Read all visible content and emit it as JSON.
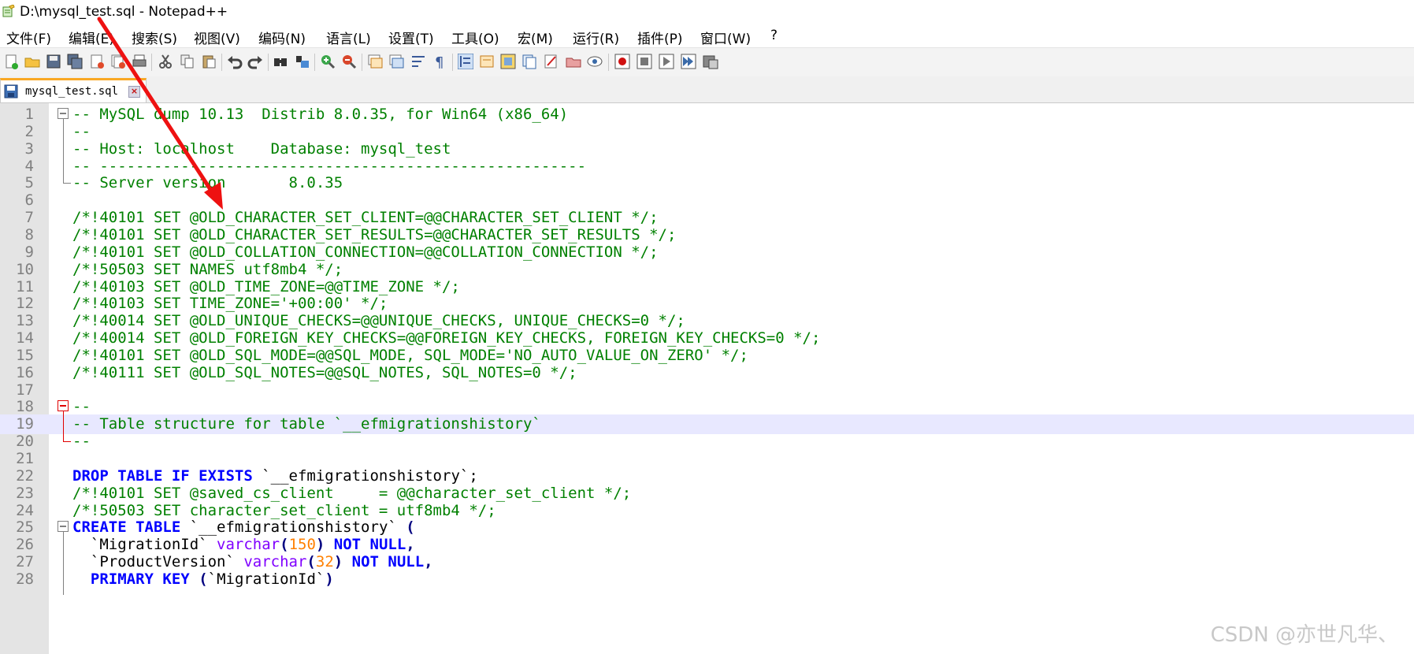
{
  "window": {
    "title": "D:\\mysql_test.sql - Notepad++"
  },
  "menu": [
    {
      "label": "文件(F)"
    },
    {
      "label": "编辑(E)"
    },
    {
      "label": "搜索(S)"
    },
    {
      "label": "视图(V)"
    },
    {
      "label": "编码(N)"
    },
    {
      "label": "语言(L)"
    },
    {
      "label": "设置(T)"
    },
    {
      "label": "工具(O)"
    },
    {
      "label": "宏(M)"
    },
    {
      "label": "运行(R)"
    },
    {
      "label": "插件(P)"
    },
    {
      "label": "窗口(W)"
    },
    {
      "label": "?"
    }
  ],
  "toolbar": {
    "icons": [
      "new-file-icon",
      "open-file-icon",
      "save-icon",
      "save-all-icon",
      "close-icon",
      "close-all-icon",
      "print-icon",
      "cut-icon",
      "copy-icon",
      "paste-icon",
      "undo-icon",
      "redo-icon",
      "find-icon",
      "replace-icon",
      "zoom-in-icon",
      "zoom-out-icon",
      "sync-vertical-icon",
      "sync-horizontal-icon",
      "word-wrap-icon",
      "show-all-chars-icon",
      "indent-guide-icon",
      "user-language-icon",
      "doc-map-icon",
      "function-list-icon",
      "folder-workspace-icon",
      "monitoring-icon",
      "doc-list-icon",
      "record-macro-icon",
      "stop-macro-icon",
      "play-macro-icon",
      "run-macro-multiple-icon",
      "save-macro-icon"
    ]
  },
  "tab": {
    "label": "mysql_test.sql"
  },
  "editor": {
    "current_line": 19,
    "lines": [
      {
        "n": "1",
        "segs": [
          {
            "t": "-- MySQL dump 10.13  Distrib 8.0.35, for Win64 (x86_64)",
            "c": "cmt"
          }
        ]
      },
      {
        "n": "2",
        "segs": [
          {
            "t": "--",
            "c": "cmt"
          }
        ]
      },
      {
        "n": "3",
        "segs": [
          {
            "t": "-- Host: localhost    Database: mysql_test",
            "c": "cmt"
          }
        ]
      },
      {
        "n": "4",
        "segs": [
          {
            "t": "-- ------------------------------------------------------",
            "c": "cmt"
          }
        ]
      },
      {
        "n": "5",
        "segs": [
          {
            "t": "-- Server version\t8.0.35",
            "c": "cmt"
          }
        ]
      },
      {
        "n": "6",
        "segs": []
      },
      {
        "n": "7",
        "segs": [
          {
            "t": "/*!40101 SET @OLD_CHARACTER_SET_CLIENT=@@CHARACTER_SET_CLIENT */;",
            "c": "cmt"
          }
        ]
      },
      {
        "n": "8",
        "segs": [
          {
            "t": "/*!40101 SET @OLD_CHARACTER_SET_RESULTS=@@CHARACTER_SET_RESULTS */;",
            "c": "cmt"
          }
        ]
      },
      {
        "n": "9",
        "segs": [
          {
            "t": "/*!40101 SET @OLD_COLLATION_CONNECTION=@@COLLATION_CONNECTION */;",
            "c": "cmt"
          }
        ]
      },
      {
        "n": "10",
        "segs": [
          {
            "t": "/*!50503 SET NAMES utf8mb4 */;",
            "c": "cmt"
          }
        ]
      },
      {
        "n": "11",
        "segs": [
          {
            "t": "/*!40103 SET @OLD_TIME_ZONE=@@TIME_ZONE */;",
            "c": "cmt"
          }
        ]
      },
      {
        "n": "12",
        "segs": [
          {
            "t": "/*!40103 SET TIME_ZONE='+00:00' */;",
            "c": "cmt"
          }
        ]
      },
      {
        "n": "13",
        "segs": [
          {
            "t": "/*!40014 SET @OLD_UNIQUE_CHECKS=@@UNIQUE_CHECKS, UNIQUE_CHECKS=0 */;",
            "c": "cmt"
          }
        ]
      },
      {
        "n": "14",
        "segs": [
          {
            "t": "/*!40014 SET @OLD_FOREIGN_KEY_CHECKS=@@FOREIGN_KEY_CHECKS, FOREIGN_KEY_CHECKS=0 */;",
            "c": "cmt"
          }
        ]
      },
      {
        "n": "15",
        "segs": [
          {
            "t": "/*!40101 SET @OLD_SQL_MODE=@@SQL_MODE, SQL_MODE='NO_AUTO_VALUE_ON_ZERO' */;",
            "c": "cmt"
          }
        ]
      },
      {
        "n": "16",
        "segs": [
          {
            "t": "/*!40111 SET @OLD_SQL_NOTES=@@SQL_NOTES, SQL_NOTES=0 */;",
            "c": "cmt"
          }
        ]
      },
      {
        "n": "17",
        "segs": []
      },
      {
        "n": "18",
        "segs": [
          {
            "t": "--",
            "c": "cmt"
          }
        ]
      },
      {
        "n": "19",
        "segs": [
          {
            "t": "-- Table structure for table `__efmigrationshistory`",
            "c": "cmt"
          }
        ]
      },
      {
        "n": "20",
        "segs": [
          {
            "t": "--",
            "c": "cmt"
          }
        ]
      },
      {
        "n": "21",
        "segs": []
      },
      {
        "n": "22",
        "segs": [
          {
            "t": "DROP TABLE IF EXISTS",
            "c": "kw"
          },
          {
            "t": " `__efmigrationshistory`;",
            "c": "def"
          }
        ]
      },
      {
        "n": "23",
        "segs": [
          {
            "t": "/*!40101 SET @saved_cs_client     = @@character_set_client */;",
            "c": "cmt"
          }
        ]
      },
      {
        "n": "24",
        "segs": [
          {
            "t": "/*!50503 SET character_set_client = utf8mb4 */;",
            "c": "cmt"
          }
        ]
      },
      {
        "n": "25",
        "segs": [
          {
            "t": "CREATE TABLE",
            "c": "kw"
          },
          {
            "t": " `__efmigrationshistory` ",
            "c": "def"
          },
          {
            "t": "(",
            "c": "op"
          }
        ]
      },
      {
        "n": "26",
        "segs": [
          {
            "t": "  `MigrationId` ",
            "c": "def"
          },
          {
            "t": "varchar",
            "c": "type"
          },
          {
            "t": "(",
            "c": "op"
          },
          {
            "t": "150",
            "c": "num"
          },
          {
            "t": ")",
            "c": "op"
          },
          {
            "t": " NOT NULL",
            "c": "kw"
          },
          {
            "t": ",",
            "c": "op"
          }
        ]
      },
      {
        "n": "27",
        "segs": [
          {
            "t": "  `ProductVersion` ",
            "c": "def"
          },
          {
            "t": "varchar",
            "c": "type"
          },
          {
            "t": "(",
            "c": "op"
          },
          {
            "t": "32",
            "c": "num"
          },
          {
            "t": ")",
            "c": "op"
          },
          {
            "t": " NOT NULL",
            "c": "kw"
          },
          {
            "t": ",",
            "c": "op"
          }
        ]
      },
      {
        "n": "28",
        "segs": [
          {
            "t": "  ",
            "c": "def"
          },
          {
            "t": "PRIMARY KEY",
            "c": "kw"
          },
          {
            "t": " ",
            "c": "def"
          },
          {
            "t": "(",
            "c": "op"
          },
          {
            "t": "`MigrationId`",
            "c": "def"
          },
          {
            "t": ")",
            "c": "op"
          }
        ]
      }
    ]
  },
  "watermark": "CSDN @亦世凡华、"
}
